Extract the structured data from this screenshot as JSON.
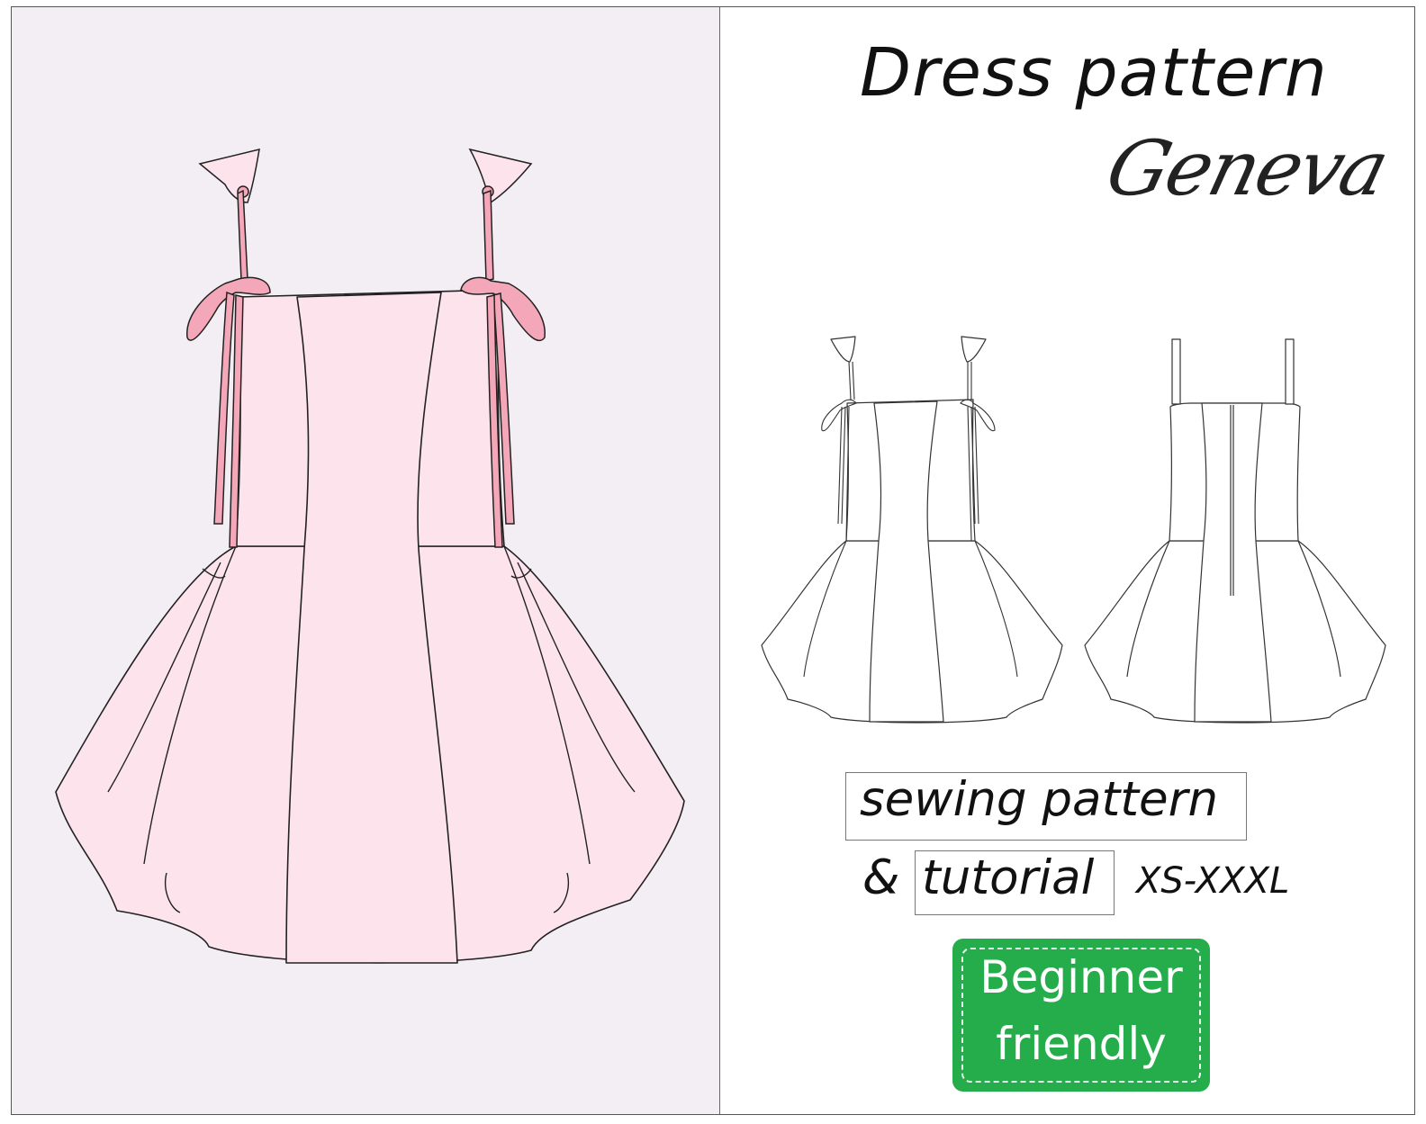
{
  "title": "Dress pattern",
  "subtitle": "Geneva",
  "sewing_label": "sewing pattern",
  "ampersand": "&",
  "tutorial_label": "tutorial",
  "sizes": "XS-XXXL",
  "badge": {
    "line1": "Beginner",
    "line2": "friendly"
  },
  "colors": {
    "dress_fill": "#fde4ec",
    "tie_pink": "#f4a7b9",
    "left_bg": "#f3eef3",
    "badge_green": "#24ad4a"
  }
}
